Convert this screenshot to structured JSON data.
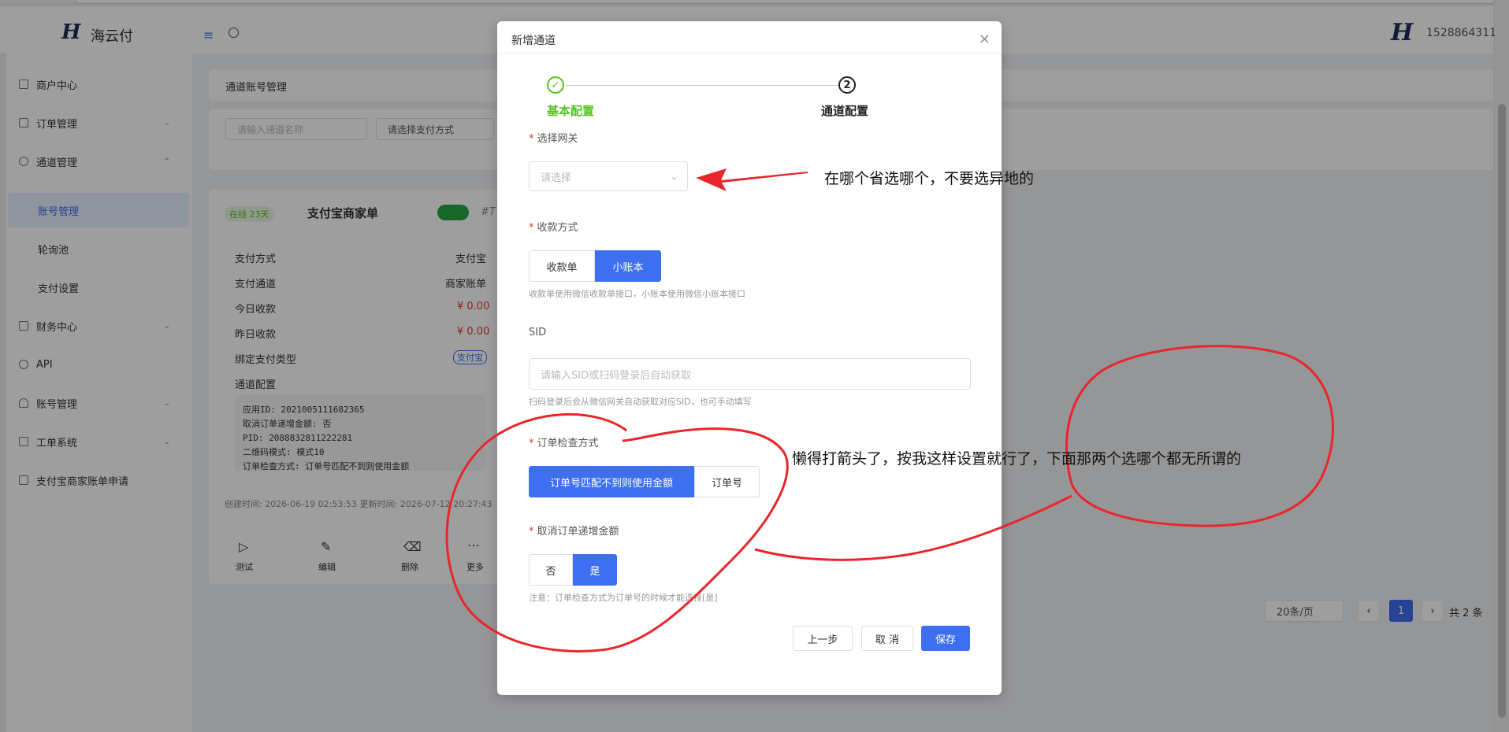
{
  "header": {
    "logo_text": "海云付",
    "user_name": "1528864311"
  },
  "sidebar": {
    "items": [
      {
        "label": "商户中心"
      },
      {
        "label": "订单管理"
      },
      {
        "label": "通道管理"
      },
      {
        "label": "财务中心"
      },
      {
        "label": "API"
      },
      {
        "label": "账号管理"
      },
      {
        "label": "工单系统"
      },
      {
        "label": "支付宝商家账单申请"
      }
    ],
    "sub_items": [
      {
        "label": "账号管理"
      },
      {
        "label": "轮询池"
      },
      {
        "label": "支付设置"
      }
    ]
  },
  "background_page": {
    "title": "通道账号管理",
    "filter_name_placeholder": "请输入通道名称",
    "filter_pay_placeholder": "请选择支付方式",
    "card": {
      "status_badge": "在线 23天",
      "name": "支付宝商家单",
      "tag_text": "#T",
      "rows": [
        {
          "label": "支付方式",
          "value": "支付宝"
        },
        {
          "label": "支付通道",
          "value": "商家账单"
        },
        {
          "label": "今日收款",
          "value": "¥ 0.00"
        },
        {
          "label": "昨日收款",
          "value": "¥ 0.00"
        },
        {
          "label": "绑定支付类型",
          "value": "支付宝"
        },
        {
          "label": "通道配置",
          "value": ""
        }
      ],
      "config_lines": [
        "应用ID: 2021005111682365",
        "取消订单递增金额: 否",
        "PID: 2088832811222281",
        "二维码模式: 模式10",
        "订单检查方式: 订单号匹配不到则使用金额"
      ],
      "timestamps": "创建时间: 2026-06-19 02:53:53 更新时间: 2026-07-12 20:27:43",
      "actions": [
        {
          "label": "测试"
        },
        {
          "label": "编辑"
        },
        {
          "label": "删除"
        },
        {
          "label": "更多"
        }
      ]
    },
    "pagination": {
      "page_size": "20条/页",
      "current_page": "1",
      "total": "共 2 条"
    }
  },
  "modal": {
    "title": "新增通道",
    "steps": [
      {
        "label": "基本配置"
      },
      {
        "label": "通道配置",
        "number": "2"
      }
    ],
    "gateway": {
      "label": "选择网关",
      "placeholder": "请选择"
    },
    "collect_method": {
      "label": "收款方式",
      "options": [
        "收款单",
        "小账本"
      ],
      "selected": "小账本",
      "hint": "收款单使用微信收款单接口，小账本使用微信小账本接口"
    },
    "sid": {
      "label": "SID",
      "placeholder": "请输入SID或扫码登录后自动获取",
      "hint": "扫码登录后会从微信网关自动获取对应SID，也可手动填写"
    },
    "order_check": {
      "label": "订单检查方式",
      "options": [
        "订单号匹配不到则使用金额",
        "订单号"
      ],
      "selected": "订单号匹配不到则使用金额"
    },
    "cancel_increment": {
      "label": "取消订单递增金额",
      "options": [
        "否",
        "是"
      ],
      "selected": "是",
      "hint": "注意：订单检查方式为订单号的时候才能选择[是]"
    },
    "buttons": {
      "prev": "上一步",
      "cancel": "取 消",
      "save": "保存"
    }
  },
  "annotations": {
    "arrow_note": "在哪个省选哪个，不要选异地的",
    "circle_note": "懒得打箭头了，按我这样设置就行了，下面那两个选哪个都无所谓的",
    "annotation_color": "#e8262b"
  },
  "colors": {
    "primary": "#3e6ff0",
    "success": "#52c41a",
    "danger": "#e53935"
  }
}
